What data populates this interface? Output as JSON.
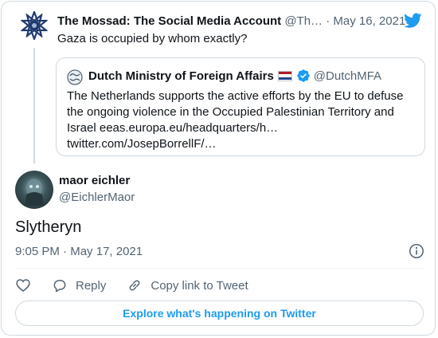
{
  "colors": {
    "twitter_blue": "#1d9bf0",
    "text_primary": "#0f1419",
    "text_secondary": "#536471",
    "border": "#cfd9de"
  },
  "parent_tweet": {
    "author_name": "The Mossad: The Social Media Account",
    "handle": "@Th…",
    "separator": "·",
    "date": "May 16, 2021",
    "text": "Gaza is occupied by whom exactly?",
    "avatar_icon": "star-emblem-icon",
    "quoted_tweet": {
      "author_name": "Dutch Ministry of Foreign Affairs",
      "flag_icon": "netherlands-flag-icon",
      "verified_icon": "verified-badge-icon",
      "handle": "@DutchMFA",
      "text_lines": [
        "The Netherlands supports the active efforts by the EU to defuse",
        "the ongoing violence in the Occupied Palestinian Territory and",
        "Israel eeas.europa.eu/headquarters/h…",
        "twitter.com/JosepBorrellF/…"
      ]
    }
  },
  "main_tweet": {
    "author_name": "maor eichler",
    "handle": "@EichlerMaor",
    "text": "Slytheryn",
    "time": "9:05 PM",
    "separator": "·",
    "date": "May 17, 2021"
  },
  "actions": {
    "like_icon": "heart-icon",
    "reply_label": "Reply",
    "reply_icon": "reply-bubble-icon",
    "copy_label": "Copy link to Tweet",
    "copy_icon": "link-icon"
  },
  "explore_button": "Explore what's happening on Twitter",
  "branding": {
    "logo_icon": "twitter-bird-icon"
  }
}
